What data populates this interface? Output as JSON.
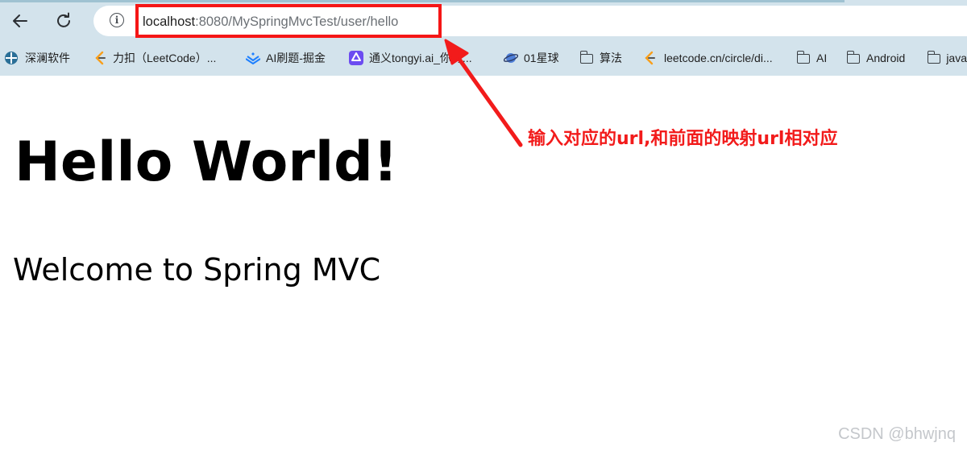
{
  "browser": {
    "back_icon": "arrow-left-icon",
    "reload_icon": "reload-icon",
    "site_info_icon": "info-icon",
    "url_host": "localhost",
    "url_rest": ":8080/MySpringMvcTest/user/hello",
    "bookmarks": [
      {
        "label": "深澜软件",
        "icon": "deepin-icon"
      },
      {
        "label": "力扣（LeetCode）...",
        "icon": "leetcode-icon"
      },
      {
        "label": "AI刷题-掘金",
        "icon": "juejin-icon"
      },
      {
        "label": "通义tongyi.ai_你的...",
        "icon": "tongyi-icon"
      },
      {
        "label": "01星球",
        "icon": "planet-icon"
      },
      {
        "label": "算法",
        "icon": "folder-icon"
      },
      {
        "label": "leetcode.cn/circle/di...",
        "icon": "leetcode-icon"
      },
      {
        "label": "AI",
        "icon": "folder-icon"
      },
      {
        "label": "Android",
        "icon": "folder-icon"
      },
      {
        "label": "java",
        "icon": "folder-icon"
      }
    ]
  },
  "page": {
    "heading": "Hello World!",
    "subheading": "Welcome to Spring MVC"
  },
  "annotation": {
    "text": "输入对应的url,和前面的映射url相对应",
    "color": "#f21b1b"
  },
  "watermark": "CSDN @bhwjnq"
}
